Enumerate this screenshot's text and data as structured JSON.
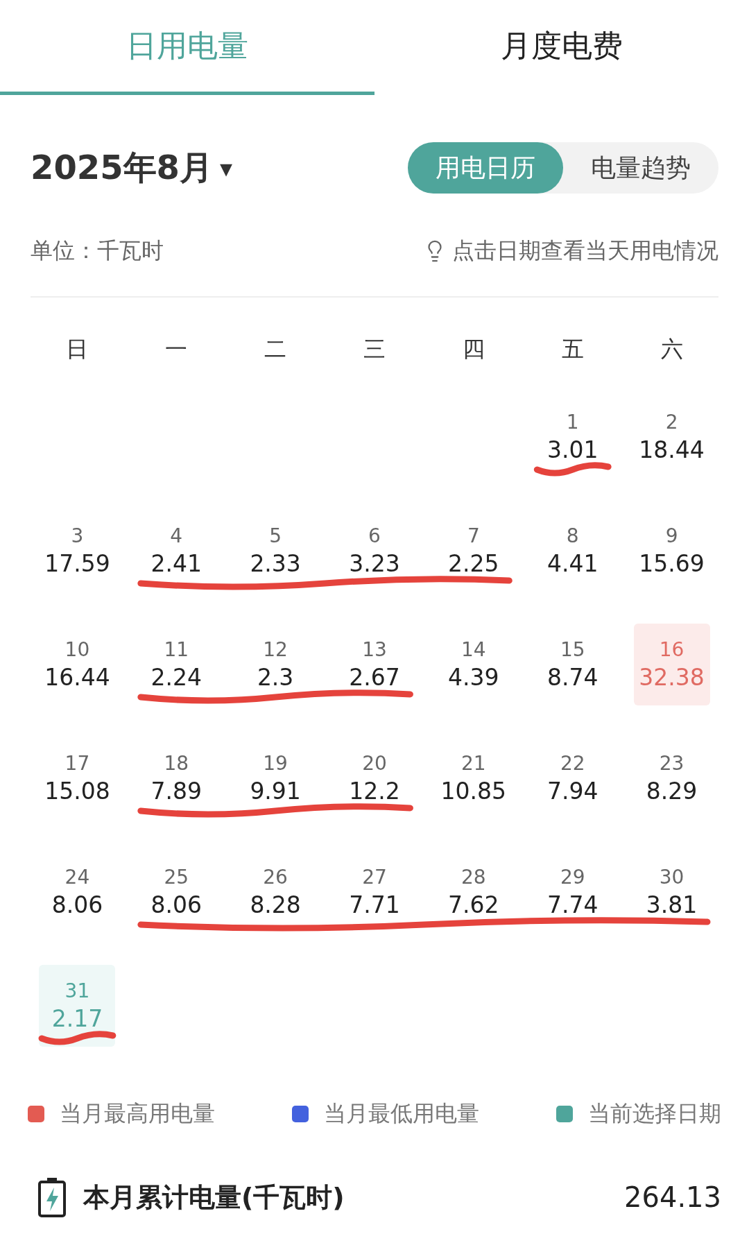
{
  "tabs": [
    {
      "label": "日用电量",
      "selected": true
    },
    {
      "label": "月度电费",
      "selected": false
    }
  ],
  "month": {
    "label": "2025年8月",
    "caret": "▾"
  },
  "view_toggle": [
    {
      "label": "用电日历",
      "selected": true
    },
    {
      "label": "电量趋势",
      "selected": false
    }
  ],
  "unit": "单位：千瓦时",
  "hint": "点击日期查看当天用电情况",
  "weekdays": [
    "日",
    "一",
    "二",
    "三",
    "四",
    "五",
    "六"
  ],
  "weeks": [
    {
      "days": [
        {
          "kind": "blank"
        },
        {
          "kind": "blank"
        },
        {
          "kind": "blank"
        },
        {
          "kind": "blank"
        },
        {
          "kind": "blank"
        },
        {
          "kind": "day",
          "date": "1",
          "value": "3.01",
          "selected": false,
          "underlined": true
        },
        {
          "kind": "day",
          "date": "2",
          "value": "18.44",
          "selected": false,
          "underlined": false
        }
      ]
    },
    {
      "days": [
        {
          "kind": "day",
          "date": "3",
          "value": "17.59",
          "selected": false,
          "underlined": false
        },
        {
          "kind": "day",
          "date": "4",
          "value": "2.41",
          "selected": false,
          "underlined": true
        },
        {
          "kind": "day",
          "date": "5",
          "value": "2.33",
          "selected": false,
          "underlined": true
        },
        {
          "kind": "day",
          "date": "6",
          "value": "3.23",
          "selected": false,
          "underlined": true
        },
        {
          "kind": "day",
          "date": "7",
          "value": "2.25",
          "selected": false,
          "underlined": true
        },
        {
          "kind": "day",
          "date": "8",
          "value": "4.41",
          "selected": false,
          "underlined": false
        },
        {
          "kind": "day",
          "date": "9",
          "value": "15.69",
          "selected": false,
          "underlined": false
        }
      ]
    },
    {
      "days": [
        {
          "kind": "day",
          "date": "10",
          "value": "16.44",
          "selected": false,
          "underlined": false
        },
        {
          "kind": "day",
          "date": "11",
          "value": "2.24",
          "selected": false,
          "underlined": true
        },
        {
          "kind": "day",
          "date": "12",
          "value": "2.3",
          "selected": false,
          "underlined": true
        },
        {
          "kind": "day",
          "date": "13",
          "value": "2.67",
          "selected": false,
          "underlined": true
        },
        {
          "kind": "day",
          "date": "14",
          "value": "4.39",
          "selected": false,
          "underlined": false
        },
        {
          "kind": "day",
          "date": "15",
          "value": "8.74",
          "selected": false,
          "underlined": false
        },
        {
          "kind": "day",
          "date": "16",
          "value": "32.38",
          "highest": true,
          "selected": false,
          "underlined": false
        }
      ]
    },
    {
      "days": [
        {
          "kind": "day",
          "date": "17",
          "value": "15.08",
          "selected": false,
          "underlined": false
        },
        {
          "kind": "day",
          "date": "18",
          "value": "7.89",
          "selected": false,
          "underlined": true
        },
        {
          "kind": "day",
          "date": "19",
          "value": "9.91",
          "selected": false,
          "underlined": true
        },
        {
          "kind": "day",
          "date": "20",
          "value": "12.2",
          "selected": false,
          "underlined": true
        },
        {
          "kind": "day",
          "date": "21",
          "value": "10.85",
          "selected": false,
          "underlined": false
        },
        {
          "kind": "day",
          "date": "22",
          "value": "7.94",
          "selected": false,
          "underlined": false
        },
        {
          "kind": "day",
          "date": "23",
          "value": "8.29",
          "selected": false,
          "underlined": false
        }
      ]
    },
    {
      "days": [
        {
          "kind": "day",
          "date": "24",
          "value": "8.06",
          "selected": false,
          "underlined": false
        },
        {
          "kind": "day",
          "date": "25",
          "value": "8.06",
          "selected": false,
          "underlined": true
        },
        {
          "kind": "day",
          "date": "26",
          "value": "8.28",
          "selected": false,
          "underlined": true
        },
        {
          "kind": "day",
          "date": "27",
          "value": "7.71",
          "selected": false,
          "underlined": true
        },
        {
          "kind": "day",
          "date": "28",
          "value": "7.62",
          "selected": false,
          "underlined": true
        },
        {
          "kind": "day",
          "date": "29",
          "value": "7.74",
          "selected": false,
          "underlined": true
        },
        {
          "kind": "day",
          "date": "30",
          "value": "3.81",
          "selected": false,
          "underlined": true
        }
      ]
    },
    {
      "days": [
        {
          "kind": "day",
          "date": "31",
          "value": "2.17",
          "selected": true,
          "underlined": true
        },
        {
          "kind": "blank"
        },
        {
          "kind": "blank"
        },
        {
          "kind": "blank"
        },
        {
          "kind": "blank"
        },
        {
          "kind": "blank"
        },
        {
          "kind": "blank"
        }
      ]
    }
  ],
  "legend": [
    {
      "label": "当月最高用电量",
      "color": "#e35b52"
    },
    {
      "label": "当月最低用电量",
      "color": "#4361de"
    },
    {
      "label": "当前选择日期",
      "color": "#4fa59b"
    }
  ],
  "total": {
    "label": "本月累计电量(千瓦时)",
    "value": "264.13"
  }
}
